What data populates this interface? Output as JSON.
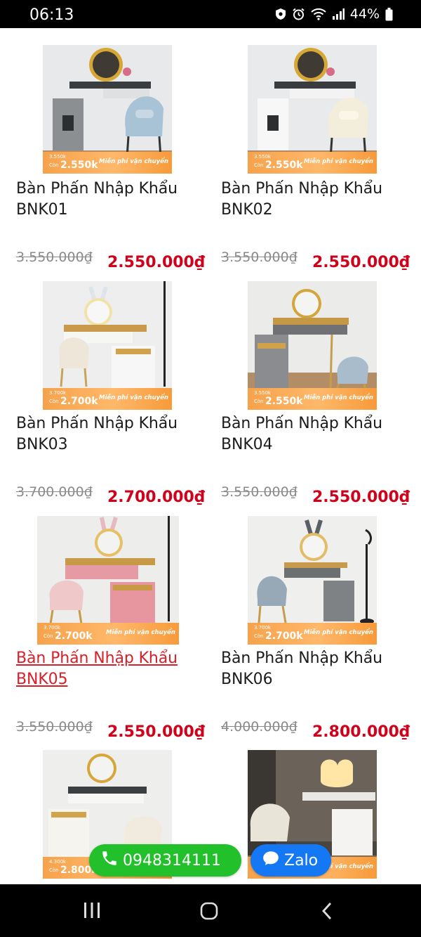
{
  "status_bar": {
    "time": "06:13",
    "battery": "44%",
    "icons": [
      "shield-icon",
      "alarm-icon",
      "wifi-icon",
      "signal-icon",
      "battery-icon"
    ]
  },
  "products": [
    {
      "name_line1": "Bàn Phấn Nhập Khẩu",
      "name_line2": "BNK01",
      "old_price": "3.550.000₫",
      "new_price": "2.550.000₫",
      "banner_old": "3.550k",
      "banner_can": "Còn",
      "banner_new": "2.550k",
      "banner_ship": "Miễn phí vận chuyển"
    },
    {
      "name_line1": "Bàn Phấn Nhập Khẩu",
      "name_line2": "BNK02",
      "old_price": "3.550.000₫",
      "new_price": "2.550.000₫",
      "banner_old": "3.550k",
      "banner_can": "Còn",
      "banner_new": "2.550k",
      "banner_ship": "Miễn phí vận chuyển"
    },
    {
      "name_line1": "Bàn Phấn Nhập Khẩu",
      "name_line2": "BNK03",
      "old_price": "3.700.000₫",
      "new_price": "2.700.000₫",
      "banner_old": "3.700k",
      "banner_can": "Còn",
      "banner_new": "2.700k",
      "banner_ship": "Miễn phí vận chuyển"
    },
    {
      "name_line1": "Bàn Phấn Nhập Khẩu",
      "name_line2": "BNK04",
      "old_price": "3.550.000₫",
      "new_price": "2.550.000₫",
      "banner_old": "3.550k",
      "banner_can": "Còn",
      "banner_new": "2.550k",
      "banner_ship": "Miễn phí vận chuyển"
    },
    {
      "name_line1": "Bàn Phấn Nhập Khẩu",
      "name_line2": "BNK05",
      "old_price": "3.550.000₫",
      "new_price": "2.550.000₫",
      "banner_old": "3.700k",
      "banner_can": "Còn",
      "banner_new": "2.700k",
      "banner_ship": "Miễn phí vận chuyển"
    },
    {
      "name_line1": "Bàn Phấn Nhập Khẩu",
      "name_line2": "BNK06",
      "old_price": "4.000.000₫",
      "new_price": "2.800.000₫",
      "banner_old": "3.700k",
      "banner_can": "Còn",
      "banner_new": "2.700k",
      "banner_ship": "Miễn phí vận chuyển"
    },
    {
      "banner_old": "4.300k",
      "banner_can": "Còn",
      "banner_new": "2.800k",
      "banner_ship": ""
    },
    {
      "banner_old": "",
      "banner_can": "",
      "banner_new": "",
      "banner_ship": "Miễn phí vận chuyển"
    }
  ],
  "contact": {
    "phone": "0948314111",
    "zalo": "Zalo"
  },
  "colors": {
    "price_red": "#d0021b",
    "link_red": "#d9202a",
    "phone_green": "#22c02b",
    "zalo_blue": "#1478f5",
    "banner_orange": "#f6a24b"
  }
}
